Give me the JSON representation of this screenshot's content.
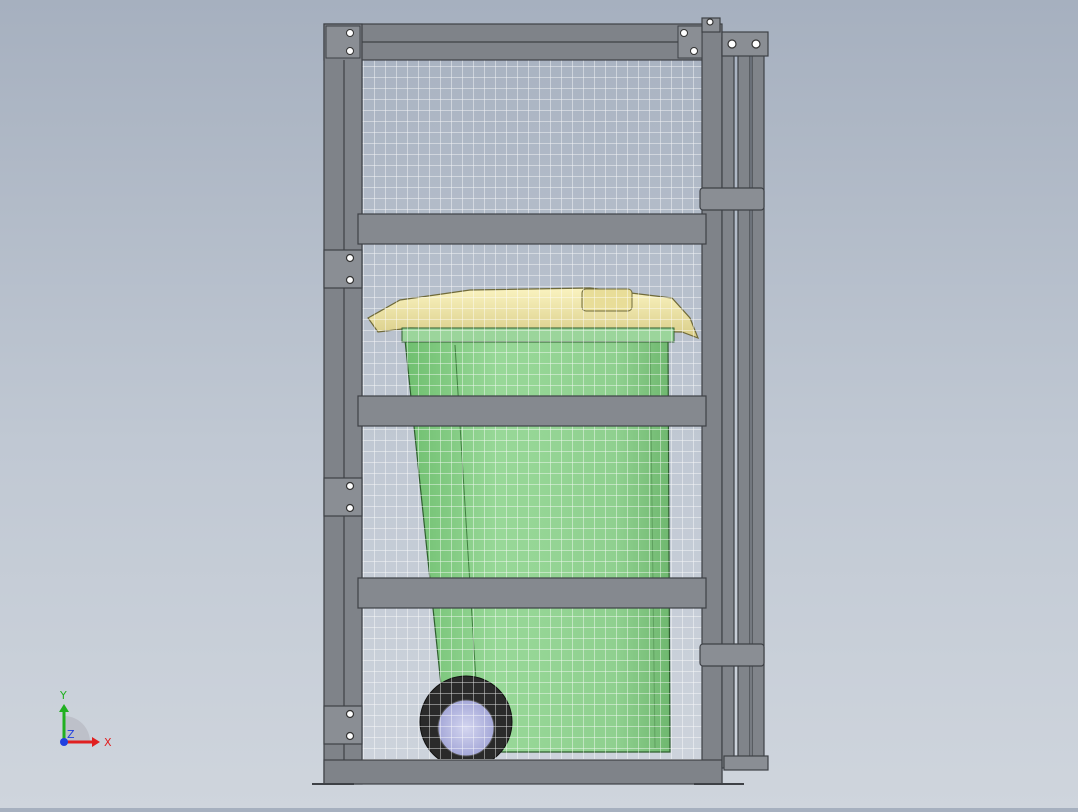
{
  "scene": {
    "model": "bin-enclosure-gate",
    "colors": {
      "background_top": "#a6b0bf",
      "background_bottom": "#cfd5dd",
      "frame": "#7f8389",
      "frame_dark": "#4a4d52",
      "mesh": "#ffffff",
      "bin_body": "#8fd08f",
      "bin_lid": "#f0e7a6",
      "wheel": "#2a2a2a"
    }
  },
  "triad": {
    "x_label": "X",
    "y_label": "Y",
    "z_label": "Z",
    "x_color": "#e02020",
    "y_color": "#20b020",
    "z_color": "#2040e0"
  }
}
